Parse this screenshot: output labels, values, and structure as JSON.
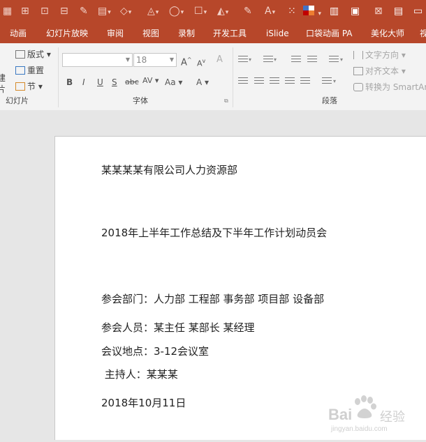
{
  "colors": {
    "accent": "#b7472a",
    "ribbon_bg": "#f3f3f3",
    "canvas_bg": "#e6e6e6"
  },
  "quick_access": [
    "grid-icon",
    "format-painter-icon",
    "select-icon",
    "paint-icon",
    "pen-icon",
    "paste-icon",
    "shape-icon",
    "fill-color-icon",
    "shape-outline-icon",
    "edit-icon",
    "effects-icon",
    "pencil-icon",
    "font-color-icon",
    "grid-dots-icon",
    "theme-colors-icon",
    "layout-icon",
    "image-icon",
    "text-box-icon"
  ],
  "tabs": [
    "动画",
    "幻灯片放映",
    "审阅",
    "视图",
    "录制",
    "开发工具",
    "iSlide",
    "口袋动画 PA",
    "美化大师",
    "视"
  ],
  "ribbon": {
    "slides_group": {
      "new_partial_1": "建",
      "new_partial_2": "片",
      "layout": "版式",
      "reset": "重置",
      "section": "节",
      "label": "幻灯片"
    },
    "font_group": {
      "font_name": "",
      "font_size": "18",
      "grow": "A",
      "shrink": "A",
      "clear": "A",
      "bold": "B",
      "italic": "I",
      "underline": "U",
      "strike": "S",
      "abc": "abc",
      "spacing": "AV",
      "case": "Aa",
      "color": "A",
      "label": "字体"
    },
    "paragraph_group": {
      "text_direction": "文字方向",
      "align_text": "对齐文本",
      "smartart": "转换为 SmartArt",
      "label": "段落"
    }
  },
  "slide": {
    "company": "某某某某有限公司人力资源部",
    "title": "2018年上半年工作总结及下半年工作计划动员会",
    "departments": "参会部门：人力部  工程部  事务部  项目部  设备部",
    "attendees": "参会人员：某主任  某部长  某经理",
    "location": "会议地点：3-12会议室",
    "host": " 主持人：某某某",
    "date": "2018年10月11日"
  },
  "watermark": {
    "brand": "Bai",
    "brand_cn": "经验",
    "url": "jingyan.baidu.com"
  }
}
